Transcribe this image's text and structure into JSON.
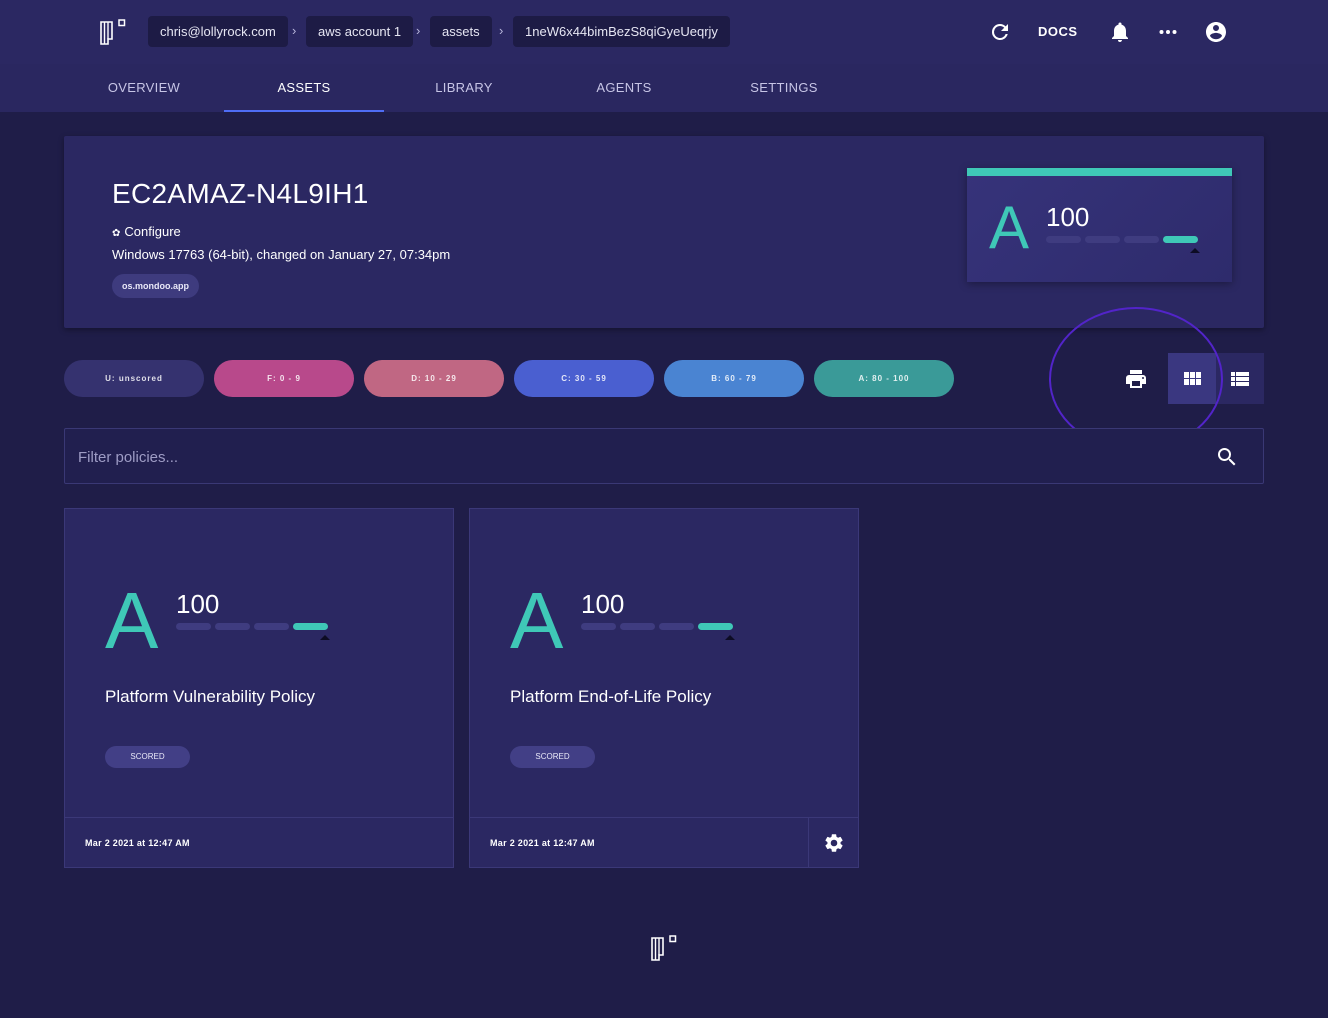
{
  "breadcrumbs": [
    "chris@lollyrock.com",
    "aws account 1",
    "assets",
    "1neW6x44bimBezS8qiGyeUeqrjy"
  ],
  "breadcrumb_separator": "›",
  "header": {
    "docs_label": "DOCS",
    "icons": [
      "refresh-icon",
      "bell-icon",
      "more-horizontal-icon",
      "account-circle-icon"
    ]
  },
  "tabs": [
    {
      "label": "OVERVIEW",
      "active": false
    },
    {
      "label": "ASSETS",
      "active": true
    },
    {
      "label": "LIBRARY",
      "active": false
    },
    {
      "label": "AGENTS",
      "active": false
    },
    {
      "label": "SETTINGS",
      "active": false
    }
  ],
  "asset": {
    "title": "EC2AMAZ-N4L9IH1",
    "configure_label": "Configure",
    "description": "Windows 17763 (64-bit), changed on January 27, 07:34pm",
    "tag": "os.mondoo.app",
    "grade": "A",
    "score": "100"
  },
  "filters": [
    {
      "label": "U: unscored",
      "color": "#35326f"
    },
    {
      "label": "F: 0 - 9",
      "color": "#b8498b"
    },
    {
      "label": "D: 10 - 29",
      "color": "#c06783"
    },
    {
      "label": "C: 30 - 59",
      "color": "#4a5fd0"
    },
    {
      "label": "B: 60 - 79",
      "color": "#4a84d2"
    },
    {
      "label": "A: 80 - 100",
      "color": "#3a9a98"
    }
  ],
  "view_controls": [
    "print-icon",
    "grid-view-icon",
    "list-view-icon"
  ],
  "search": {
    "placeholder": "Filter policies..."
  },
  "policies": [
    {
      "grade": "A",
      "score": "100",
      "name": "Platform Vulnerability Policy",
      "status": "SCORED",
      "date": "Mar 2 2021 at 12:47 AM"
    },
    {
      "grade": "A",
      "score": "100",
      "name": "Platform End-of-Life Policy",
      "status": "SCORED",
      "date": "Mar 2 2021 at 12:47 AM"
    }
  ],
  "colors": {
    "background": "#1f1d48",
    "surface": "#2b2862",
    "accent": "#3fc8b7",
    "tab_indicator": "#4f6df5",
    "annotation": "#5224c9"
  }
}
